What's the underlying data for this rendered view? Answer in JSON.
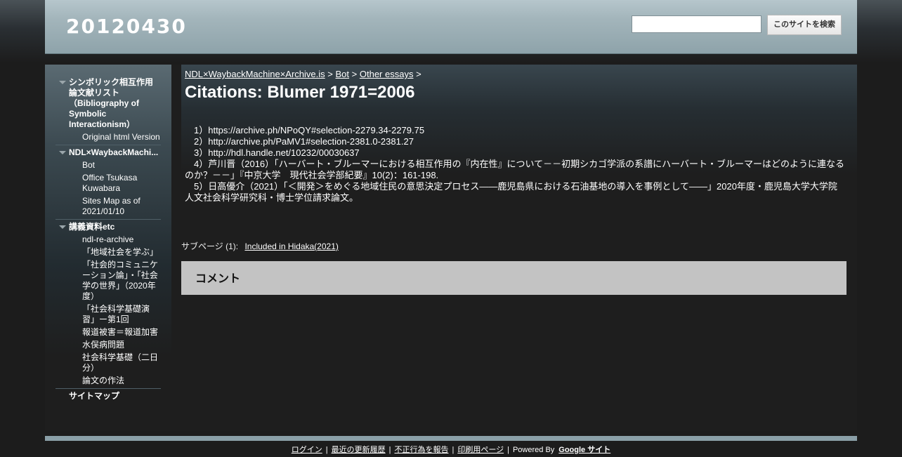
{
  "site": {
    "title": "20120430"
  },
  "search": {
    "button_label": "このサイトを検索",
    "value": ""
  },
  "sidebar": {
    "groups": [
      {
        "label": "シンボリック相互作用論文献リスト（Bibliography of Symbolic Interactionism）",
        "items": [
          "Original html Version"
        ]
      },
      {
        "label": "NDL×WaybackMachi...",
        "items": [
          "Bot",
          "Office Tsukasa Kuwabara",
          "Sites Map as of 2021/01/10"
        ]
      },
      {
        "label": "講義資料etc",
        "items": [
          "ndl-re-archive",
          "「地域社会を学ぶ」",
          "「社会的コミュニケーション論」・「社会学の世界」（2020年度）",
          "「社会科学基礎演習」ー第1回",
          "報道被害＝報道加害",
          "水俣病問題",
          "社会科学基礎（二日分）",
          "論文の作法"
        ]
      }
    ],
    "sitemap": "サイトマップ"
  },
  "breadcrumb": {
    "items": [
      "NDL×WaybackMachine×Archive.is",
      "Bot",
      "Other essays"
    ],
    "separator": ">"
  },
  "page": {
    "title": "Citations: Blumer 1971=2006",
    "citations": [
      "　1）https://archive.ph/NPoQY#selection-2279.34-2279.75",
      "　2）http://archive.ph/PaMV1#selection-2381.0-2381.27",
      "　3）http://hdl.handle.net/10232/00030637",
      "　4）芦川晋（2016）「ハーバート・ブルーマーにおける相互作用の『内在性』について－－初期シカゴ学派の系譜にハーバート・ブルーマーはどのように連なるのか？－－」『中京大学　現代社会学部紀要』10(2)：161-198.",
      "　5）日高優介（2021）「＜開発＞をめぐる地域住民の意思決定プロセス――鹿児島県における石油基地の導入を事例として――」2020年度・鹿児島大学大学院人文社会科学研究科・博士学位請求論文。"
    ],
    "subpages_label": "サブページ (1):",
    "subpage_link": "Included in Hidaka(2021)",
    "comment_heading": "コメント"
  },
  "footer": {
    "links": [
      "ログイン",
      "最近の更新履歴",
      "不正行為を報告",
      "印刷用ページ"
    ],
    "powered_by": "Powered By",
    "google_sites": "Google サイト"
  }
}
